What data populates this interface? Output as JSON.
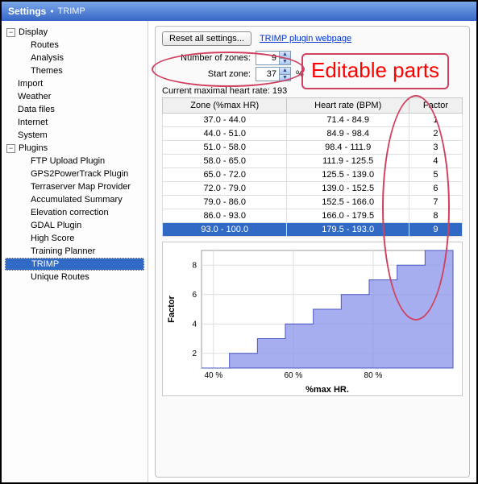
{
  "title_main": "Settings",
  "title_sub": "TRIMP",
  "tree": {
    "display": {
      "label": "Display",
      "expanded": true,
      "children": {
        "routes": "Routes",
        "analysis": "Analysis",
        "themes": "Themes"
      }
    },
    "import": "Import",
    "weather": "Weather",
    "datafiles": "Data files",
    "internet": "Internet",
    "system": "System",
    "plugins": {
      "label": "Plugins",
      "expanded": true,
      "children": {
        "ftp": "FTP Upload Plugin",
        "gps2": "GPS2PowerTrack Plugin",
        "terra": "Terraserver Map Provider",
        "acc": "Accumulated Summary",
        "elev": "Elevation correction",
        "gdal": "GDAL Plugin",
        "high": "High Score",
        "train": "Training Planner",
        "trimp": "TRIMP",
        "uniq": "Unique Routes"
      }
    }
  },
  "panel": {
    "reset_btn": "Reset all settings...",
    "webpage_link": "TRIMP plugin webpage",
    "numzones_label": "Number of zones:",
    "numzones_value": "9",
    "startzone_label": "Start zone:",
    "startzone_value": "37",
    "pct": "%",
    "hr_label": "Current maximal heart rate: 193",
    "headers": {
      "zone": "Zone (%max HR)",
      "hr": "Heart rate (BPM)",
      "factor": "Factor"
    },
    "rows": [
      {
        "zone": "37.0 - 44.0",
        "hr": "71.4 - 84.9",
        "factor": "1"
      },
      {
        "zone": "44.0 - 51.0",
        "hr": "84.9 - 98.4",
        "factor": "2"
      },
      {
        "zone": "51.0 - 58.0",
        "hr": "98.4 - 111.9",
        "factor": "3"
      },
      {
        "zone": "58.0 - 65.0",
        "hr": "111.9 - 125.5",
        "factor": "4"
      },
      {
        "zone": "65.0 - 72.0",
        "hr": "125.5 - 139.0",
        "factor": "5"
      },
      {
        "zone": "72.0 - 79.0",
        "hr": "139.0 - 152.5",
        "factor": "6"
      },
      {
        "zone": "79.0 - 86.0",
        "hr": "152.5 - 166.0",
        "factor": "7"
      },
      {
        "zone": "86.0 - 93.0",
        "hr": "166.0 - 179.5",
        "factor": "8"
      },
      {
        "zone": "93.0 - 100.0",
        "hr": "179.5 - 193.0",
        "factor": "9"
      }
    ]
  },
  "chart_data": {
    "type": "bar",
    "xlabel": "%max HR.",
    "ylabel": "Factor",
    "x_ticks": [
      "40 %",
      "60 %",
      "80 %"
    ],
    "y_ticks": [
      "2",
      "4",
      "6",
      "8"
    ],
    "categories": [
      37,
      44,
      51,
      58,
      65,
      72,
      79,
      86,
      93,
      100
    ],
    "values": [
      1,
      2,
      3,
      4,
      5,
      6,
      7,
      8,
      9
    ],
    "xlim": [
      37,
      100
    ],
    "ylim": [
      1,
      9
    ]
  },
  "annotation": "Editable parts"
}
